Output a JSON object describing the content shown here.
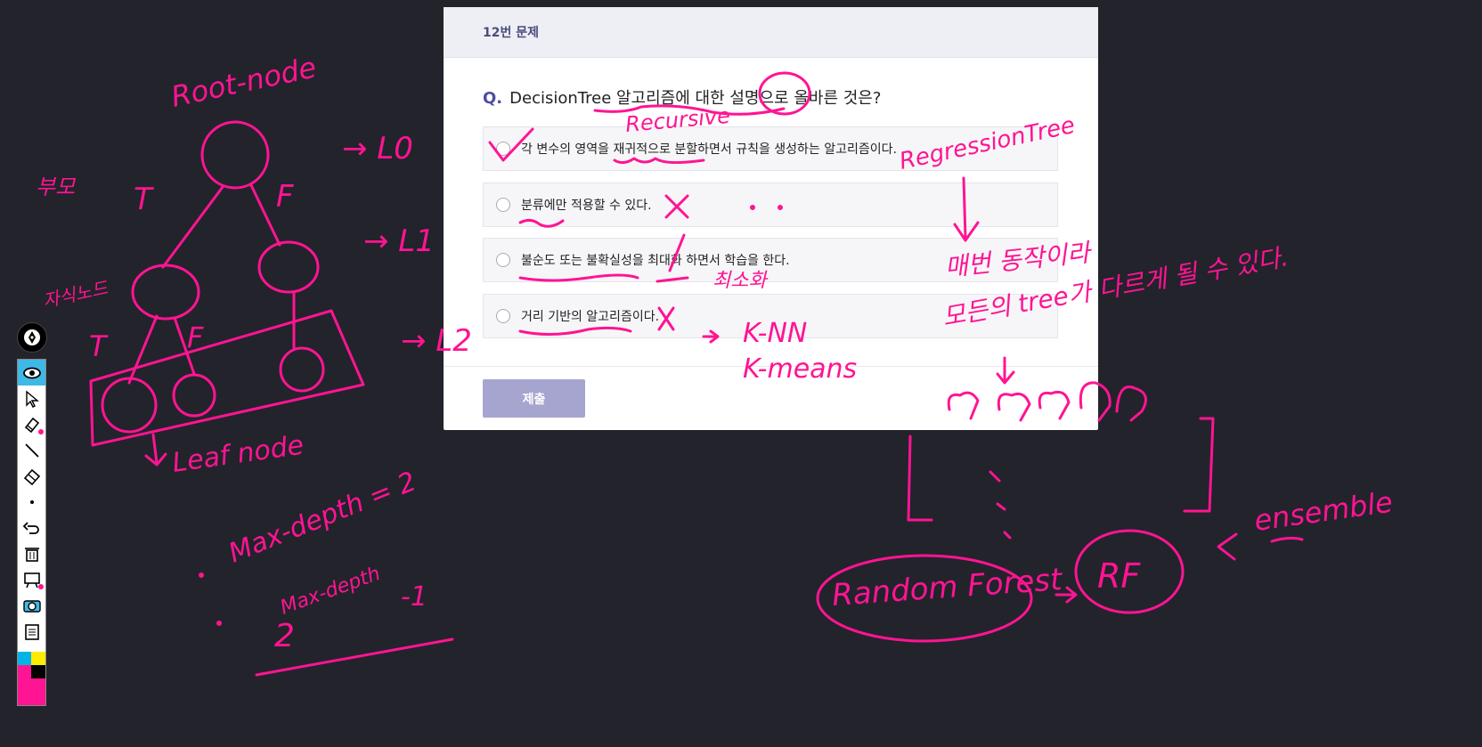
{
  "quiz": {
    "question_number": "12번 문제",
    "question_prefix": "Q.",
    "question_text": "DecisionTree 알고리즘에 대한 설명으로 올바른 것은?",
    "options": [
      {
        "label": "각 변수의 영역을 재귀적으로 분할하면서 규칙을 생성하는 알고리즘이다."
      },
      {
        "label": "분류에만 적용할 수 있다."
      },
      {
        "label": "불순도 또는 불확실성을 최대화 하면서 학습을 한다."
      },
      {
        "label": "거리 기반의 알고리즘이다."
      }
    ],
    "submit_label": "제출"
  },
  "annotations": {
    "root_node": "Root-node",
    "leaf_node": "Leaf node",
    "kr_parent": "부모",
    "kr_child": "자식노드",
    "t": "T",
    "f": "F",
    "level0": "→ L0",
    "level1": "→ L1",
    "level2": "→ L2",
    "recursive": "Recursive",
    "regression_tree": "RegressionTree",
    "minimize": "최소화",
    "knn": "K-NN",
    "kmeans": "K-means",
    "kr_every_time": "매번 동작이라",
    "kr_tree_different": "모든의 tree가 다르게 될 수 있다.",
    "max_depth_1": "Max-depth = 2",
    "max_depth_2": "Max-depth",
    "minus_one": "-1",
    "two": "2",
    "random_forest": "Random Forest",
    "rf": "RF",
    "ensemble": "ensemble"
  },
  "toolbar": {
    "tools": [
      "pen-icon",
      "eye-icon",
      "pointer-icon",
      "highlighter-icon",
      "line-icon",
      "eraser-icon",
      "dot-icon",
      "undo-icon",
      "trash-icon",
      "board-icon",
      "camera-icon",
      "clipboard-icon"
    ],
    "colors": {
      "cyan": "#00b4e6",
      "yellow": "#ffeb00",
      "magenta": "#ff1493",
      "black": "#000000"
    }
  }
}
